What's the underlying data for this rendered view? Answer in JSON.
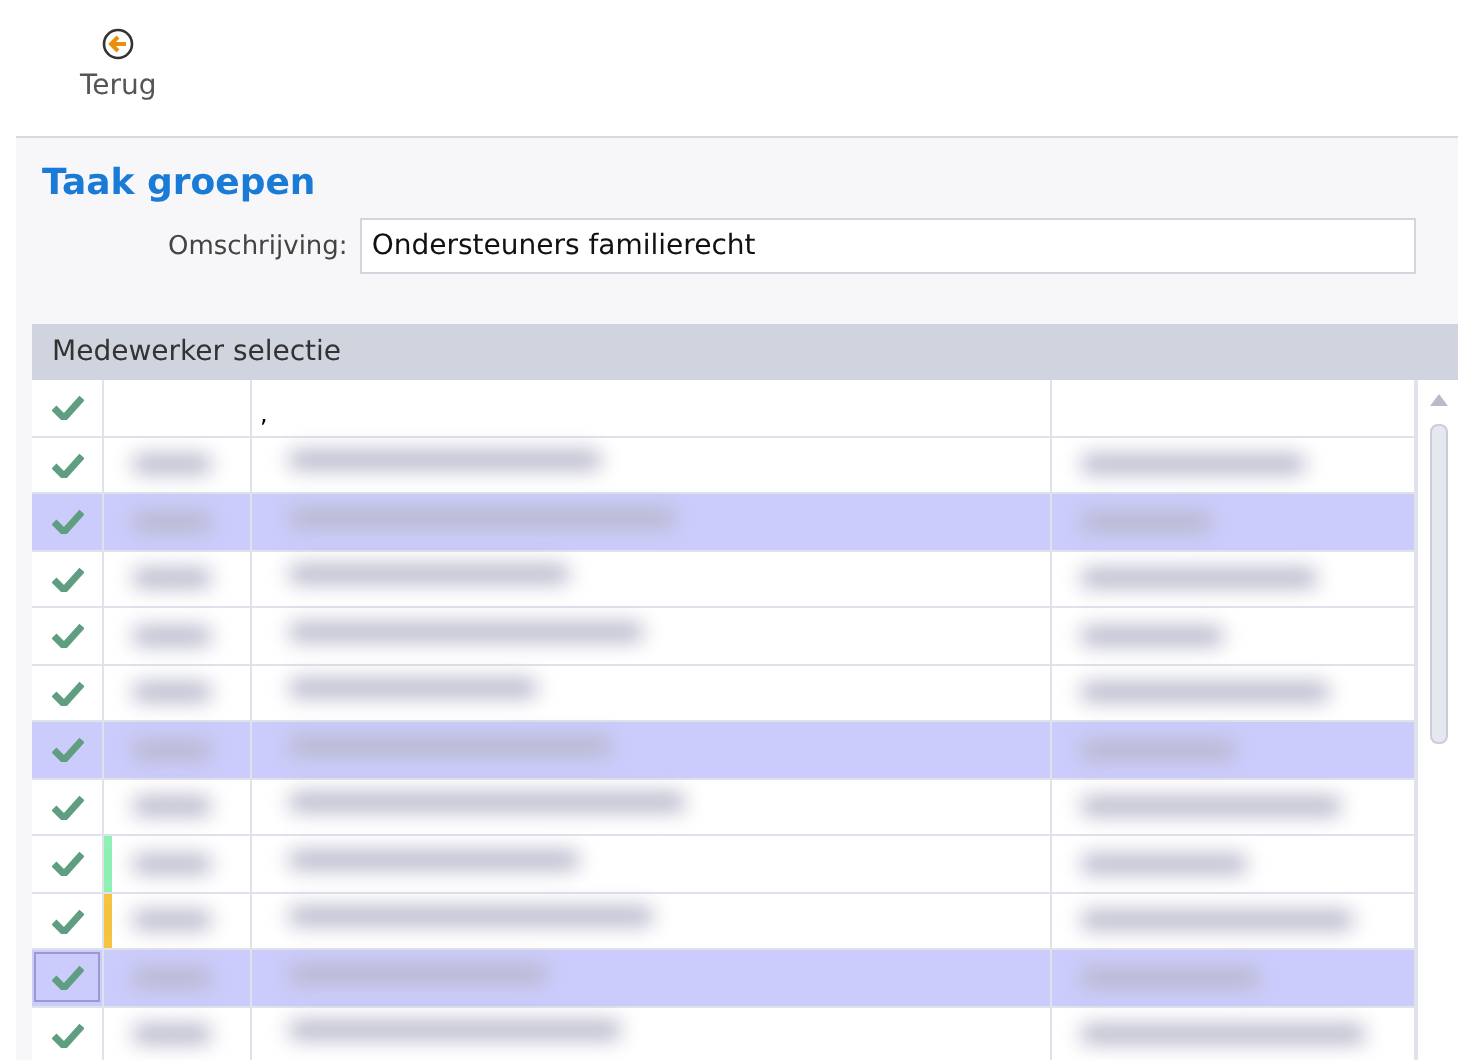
{
  "toolbar": {
    "back_button": {
      "label": "Terug"
    }
  },
  "form": {
    "title": "Taak groepen",
    "description": {
      "label": "Omschrijving:",
      "value": "Ondersteuners familierecht"
    }
  },
  "grid": {
    "title": "Medewerker selectie",
    "rows": [
      {
        "kind": "plain",
        "checked": true,
        "selected": false,
        "focused": false,
        "column_3": ","
      },
      {
        "kind": "blurred",
        "checked": true,
        "selected": false,
        "focused": false
      },
      {
        "kind": "blurred",
        "checked": true,
        "selected": true,
        "focused": false
      },
      {
        "kind": "blurred",
        "checked": true,
        "selected": false,
        "focused": false
      },
      {
        "kind": "blurred",
        "checked": true,
        "selected": false,
        "focused": false
      },
      {
        "kind": "blurred",
        "checked": true,
        "selected": false,
        "focused": false
      },
      {
        "kind": "blurred",
        "checked": true,
        "selected": true,
        "focused": false
      },
      {
        "kind": "blurred",
        "checked": true,
        "selected": false,
        "focused": false
      },
      {
        "kind": "blurred",
        "checked": true,
        "selected": false,
        "focused": false,
        "color": "#8ef0b4"
      },
      {
        "kind": "blurred",
        "checked": true,
        "selected": false,
        "focused": false,
        "color": "#f5c242"
      },
      {
        "kind": "blurred",
        "checked": true,
        "selected": true,
        "focused": true
      },
      {
        "kind": "blurred",
        "checked": true,
        "selected": false,
        "focused": false
      }
    ]
  }
}
